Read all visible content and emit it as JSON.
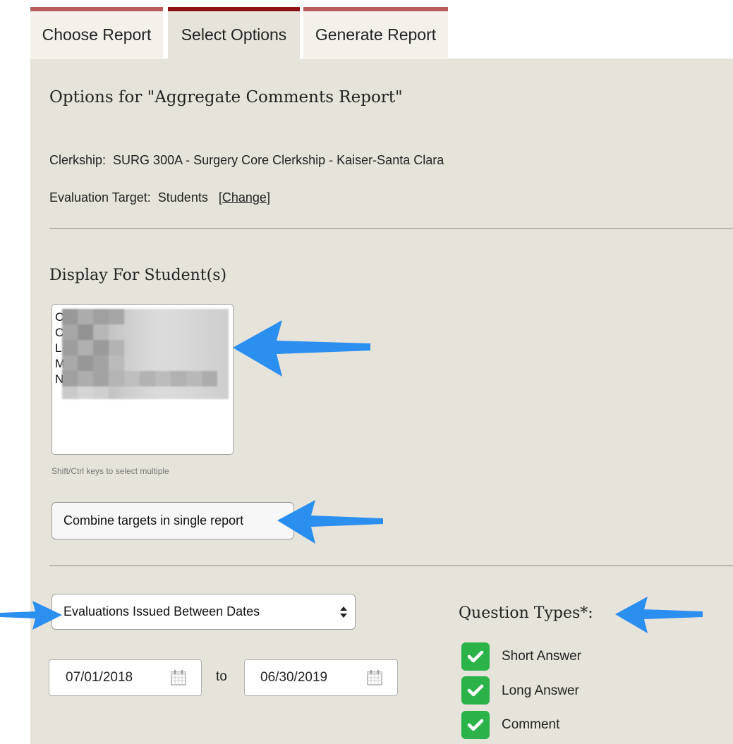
{
  "tabs": [
    {
      "label": "Choose Report"
    },
    {
      "label": "Select Options"
    },
    {
      "label": "Generate Report"
    }
  ],
  "options_title": "Options for \"Aggregate Comments Report\"",
  "clerkship": {
    "label": "Clerkship:",
    "value": "SURG 300A - Surgery Core Clerkship - Kaiser-Santa Clara"
  },
  "evaluation_target": {
    "label": "Evaluation Target:",
    "value": "Students",
    "change_open": "[",
    "change_link": "Change",
    "change_close": "]"
  },
  "display_for": {
    "heading": "Display For Student(s)",
    "visible_initials": [
      "C",
      "C",
      "L",
      "M",
      "N"
    ],
    "hint": "Shift/Ctrl keys to select multiple"
  },
  "combine_button": {
    "label": "Combine targets in single report"
  },
  "date_filter": {
    "selected": "Evaluations Issued Between Dates"
  },
  "date_range": {
    "from": "07/01/2018",
    "to_label": "to",
    "to": "06/30/2019"
  },
  "question_types": {
    "heading": "Question Types*:",
    "items": [
      {
        "label": "Short Answer",
        "checked": true
      },
      {
        "label": "Long Answer",
        "checked": true
      },
      {
        "label": "Comment",
        "checked": true
      }
    ]
  },
  "colors": {
    "accent": "#8e1212",
    "tab_border": "#b85c5c",
    "panel": "#e6e3da",
    "checkbox": "#2bb34a",
    "arrow": "#2b8ff0"
  },
  "icons": [
    "calendar-icon",
    "checkmark-icon",
    "select-arrows-icon",
    "pointer-arrow"
  ]
}
